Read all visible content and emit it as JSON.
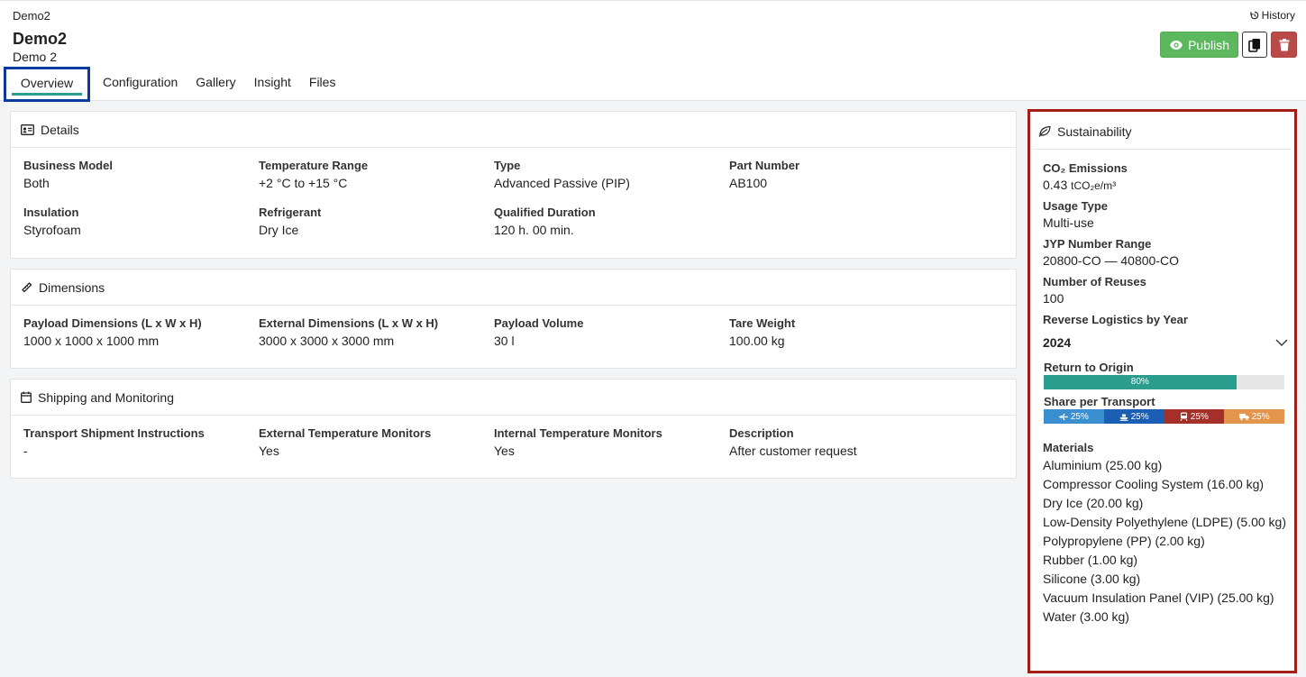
{
  "header": {
    "breadcrumb": "Demo2",
    "history_label": "History",
    "title": "Demo2",
    "subtitle": "Demo 2",
    "publish_label": "Publish"
  },
  "tabs": [
    {
      "label": "Overview",
      "active": true
    },
    {
      "label": "Configuration",
      "active": false
    },
    {
      "label": "Gallery",
      "active": false
    },
    {
      "label": "Insight",
      "active": false
    },
    {
      "label": "Files",
      "active": false
    }
  ],
  "details": {
    "title": "Details",
    "fields": [
      {
        "label": "Business Model",
        "value": "Both"
      },
      {
        "label": "Temperature Range",
        "value": "+2 °C to +15 °C"
      },
      {
        "label": "Type",
        "value": "Advanced Passive (PIP)"
      },
      {
        "label": "Part Number",
        "value": "AB100"
      },
      {
        "label": "Insulation",
        "value": "Styrofoam"
      },
      {
        "label": "Refrigerant",
        "value": "Dry Ice"
      },
      {
        "label": "Qualified Duration",
        "value": "120 h. 00 min."
      }
    ]
  },
  "dimensions": {
    "title": "Dimensions",
    "fields": [
      {
        "label": "Payload Dimensions (L x W x H)",
        "value": "1000 x 1000 x 1000 mm"
      },
      {
        "label": "External Dimensions (L x W x H)",
        "value": "3000 x 3000 x 3000 mm"
      },
      {
        "label": "Payload Volume",
        "value": "30 l"
      },
      {
        "label": "Tare Weight",
        "value": "100.00 kg"
      }
    ]
  },
  "shipping": {
    "title": "Shipping and Monitoring",
    "fields": [
      {
        "label": "Transport Shipment Instructions",
        "value": "-"
      },
      {
        "label": "External Temperature Monitors",
        "value": "Yes"
      },
      {
        "label": "Internal Temperature Monitors",
        "value": "Yes"
      },
      {
        "label": "Description",
        "value": "After customer request"
      }
    ]
  },
  "sustainability": {
    "title": "Sustainability",
    "co2_label": "CO₂ Emissions",
    "co2_value": "0.43",
    "co2_unit": "tCO₂e/m³",
    "usage_label": "Usage Type",
    "usage_value": "Multi-use",
    "jyp_label": "JYP Number Range",
    "jyp_value": "20800-CO — 40800-CO",
    "reuses_label": "Number of Reuses",
    "reuses_value": "100",
    "reverse_label": "Reverse Logistics by Year",
    "year": "2024",
    "return_label": "Return to Origin",
    "return_percent": 80,
    "return_text": "80%",
    "share_label": "Share per Transport",
    "share": [
      {
        "mode": "air",
        "icon": "plane-icon",
        "percent": 25,
        "text": "25%",
        "color": "#3a8fd0"
      },
      {
        "mode": "sea",
        "icon": "ship-icon",
        "percent": 25,
        "text": "25%",
        "color": "#1a5fb4"
      },
      {
        "mode": "rail",
        "icon": "train-icon",
        "percent": 25,
        "text": "25%",
        "color": "#a5302a"
      },
      {
        "mode": "road",
        "icon": "truck-icon",
        "percent": 25,
        "text": "25%",
        "color": "#e3954b"
      }
    ],
    "materials_label": "Materials",
    "materials": [
      "Aluminium (25.00 kg)",
      "Compressor Cooling System (16.00 kg)",
      "Dry Ice (20.00 kg)",
      "Low-Density Polyethylene (LDPE) (5.00 kg)",
      "Polypropylene (PP) (2.00 kg)",
      "Rubber (1.00 kg)",
      "Silicone (3.00 kg)",
      "Vacuum Insulation Panel (VIP) (25.00 kg)",
      "Water (3.00 kg)"
    ]
  },
  "colors": {
    "accent": "#2a9d8f",
    "publish": "#5cb85c",
    "danger": "#b94a48",
    "highlight_blue": "#0b3a9e",
    "highlight_red": "#a31f13"
  }
}
